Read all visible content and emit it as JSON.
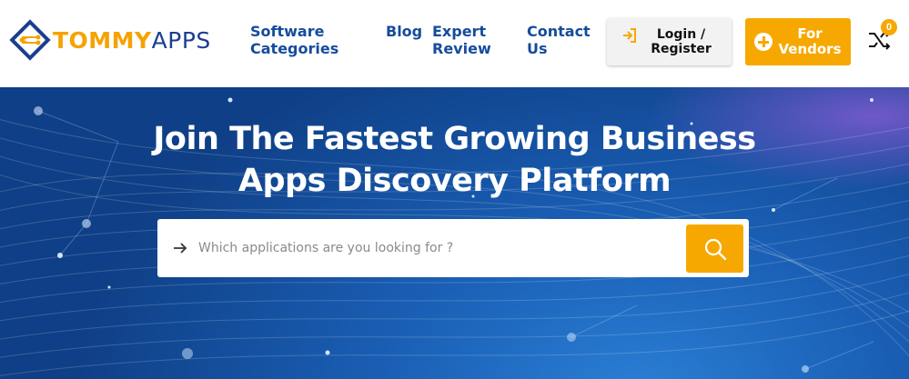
{
  "header": {
    "logo": {
      "part1": "TOMMY",
      "part2": "APPS"
    },
    "nav": [
      {
        "label": "Software Categories"
      },
      {
        "label": "Blog"
      },
      {
        "label": "Expert Review"
      },
      {
        "label": "Contact Us"
      }
    ],
    "login_label": "Login / Register",
    "vendor_label": "For Vendors",
    "compare_count": "0"
  },
  "hero": {
    "title_line1": "Join The Fastest Growing Business",
    "title_line2": "Apps Discovery Platform",
    "search": {
      "placeholder": "Which applications are you looking for ?"
    }
  },
  "colors": {
    "brand_orange": "#f7a800",
    "brand_blue": "#154c9c",
    "hero_blue": "#1a5fb5"
  },
  "icons": [
    "logo-mark-icon",
    "login-arrow-icon",
    "plus-circle-icon",
    "compare-shuffle-icon",
    "arrow-right-icon",
    "search-icon"
  ]
}
